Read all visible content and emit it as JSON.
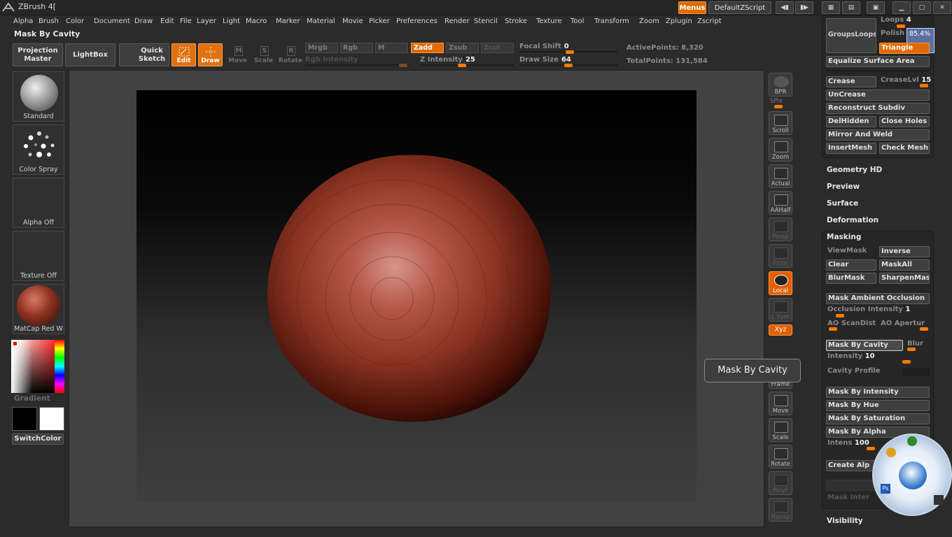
{
  "window": {
    "title": "ZBrush 4["
  },
  "titlebar": {
    "menus_label": "Menus",
    "script_label": "DefaultZScript"
  },
  "menu": [
    "Alpha",
    "Brush",
    "Color",
    "Document",
    "Draw",
    "Edit",
    "File",
    "Layer",
    "Light",
    "Macro",
    "Marker",
    "Material",
    "Movie",
    "Picker",
    "Preferences",
    "Render",
    "Stencil",
    "Stroke",
    "Texture",
    "Tool",
    "Transform",
    "Zoom",
    "Zplugin",
    "Zscript"
  ],
  "current_tool": "Mask By Cavity",
  "shelf": {
    "projection_master": "Projection Master",
    "lightbox": "LightBox",
    "quick_sketch": "Quick Sketch",
    "edit": "Edit",
    "draw": "Draw",
    "move": "Move",
    "scale": "Scale",
    "rotate": "Rotate",
    "mrgb": "Mrgb",
    "rgb": "Rgb",
    "m": "M",
    "zadd": "Zadd",
    "zsub": "Zsub",
    "zcut": "Zcut",
    "rgb_intensity": "Rgb Intensity",
    "z_intensity_label": "Z Intensity",
    "z_intensity_value": "25",
    "focal_shift_label": "Focal Shift",
    "focal_shift_value": "0",
    "draw_size_label": "Draw Size",
    "draw_size_value": "64",
    "active_points": "ActivePoints: 8,320",
    "total_points": "TotalPoints: 131,584"
  },
  "left_shelf": {
    "brush": "Standard",
    "stroke": "Color Spray",
    "alpha": "Alpha Off",
    "texture": "Texture Off",
    "material": "MatCap Red W",
    "gradient": "Gradient",
    "switch_color": "SwitchColor"
  },
  "right_shelf": [
    "BPR",
    "SPix",
    "Scroll",
    "Zoom",
    "Actual",
    "AAHalf",
    "Persp",
    "Floor",
    "Local",
    "L.Sym",
    "Xyz",
    "Frame",
    "Move",
    "Scale",
    "Rotate",
    "PolyF",
    "Transp"
  ],
  "palette": {
    "groups_loops": "GroupsLoops",
    "loops_label": "Loops",
    "loops_value": "4",
    "polish_label": "Polish",
    "polish_value": "85.4%",
    "triangle": "Triangle",
    "equalize_surface_area": "Equalize Surface Area",
    "crease": "Crease",
    "crease_lvl_label": "CreaseLvl",
    "crease_lvl_value": "15",
    "uncrease": "UnCrease",
    "reconstruct_subdiv": "Reconstruct Subdiv",
    "delhidden": "DelHidden",
    "close_holes": "Close Holes",
    "mirror_and_weld": "Mirror And Weld",
    "insertmesh": "InsertMesh",
    "check_mesh": "Check Mesh",
    "sections": [
      "Geometry HD",
      "Preview",
      "Surface",
      "Deformation"
    ],
    "masking": {
      "title": "Masking",
      "viewmask": "ViewMask",
      "inverse": "Inverse",
      "clear": "Clear",
      "maskall": "MaskAll",
      "blurmask": "BlurMask",
      "sharpenmask": "SharpenMas",
      "mask_ambient_occlusion": "Mask Ambient Occlusion",
      "occlusion_intensity_label": "Occlusion Intensity",
      "occlusion_intensity_value": "1",
      "ao_scandist": "AO ScanDist",
      "ao_aperture": "AO Apertur",
      "mask_by_cavity": "Mask By Cavity",
      "blur": "Blur",
      "intensity_label": "Intensity",
      "intensity_value": "10",
      "cavity_profile": "Cavity Profile",
      "mask_by_intensity": "Mask By Intensity",
      "mask_by_hue": "Mask By Hue",
      "mask_by_saturation": "Mask By Saturation",
      "mask_by_alpha": "Mask By Alpha",
      "intens_label": "Intens",
      "intens_value": "100",
      "create_alpha": "Create Alp",
      "mask_inter": "Mask Inter"
    },
    "visibility": "Visibility"
  },
  "tooltip": "Mask By Cavity",
  "colors": {
    "accent": "#e06a00",
    "sphere": "#8e3220",
    "panel": "#262626"
  }
}
